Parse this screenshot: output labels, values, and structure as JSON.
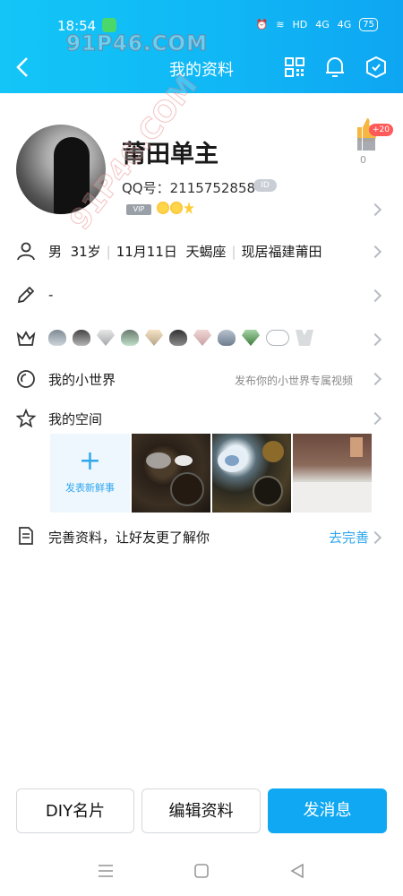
{
  "status_bar": {
    "time": "18:54",
    "net_label": "HD",
    "signal_1": "4G",
    "signal_2": "4G",
    "battery": "75"
  },
  "watermark": {
    "text": "91P46.COM",
    "diagonal": "91P46.COM"
  },
  "nav": {
    "title": "我的资料"
  },
  "profile": {
    "name": "莆田单主",
    "qq_label": "QQ号：",
    "qq_number": "2115752858",
    "id_badge": "ID",
    "vip_badge": "VIP",
    "like_badge": "+20",
    "like_count": "0"
  },
  "info_row": {
    "gender": "男",
    "age": "31岁",
    "birthday": "11月11日",
    "zodiac": "天蝎座",
    "location": "现居福建莆田"
  },
  "signature_row": {
    "text": "-"
  },
  "world_row": {
    "label": "我的小世界",
    "hint": "发布你的小世界专属视频"
  },
  "space_row": {
    "label": "我的空间",
    "post_caption": "发表新鲜事"
  },
  "complete_row": {
    "label": "完善资料，让好友更了解你",
    "action": "去完善"
  },
  "buttons": {
    "diy": "DIY名片",
    "edit": "编辑资料",
    "message": "发消息"
  },
  "colors": {
    "header_blue": "#10b7f5",
    "accent_blue": "#10a8f2",
    "like_red": "#ff5a5a"
  }
}
